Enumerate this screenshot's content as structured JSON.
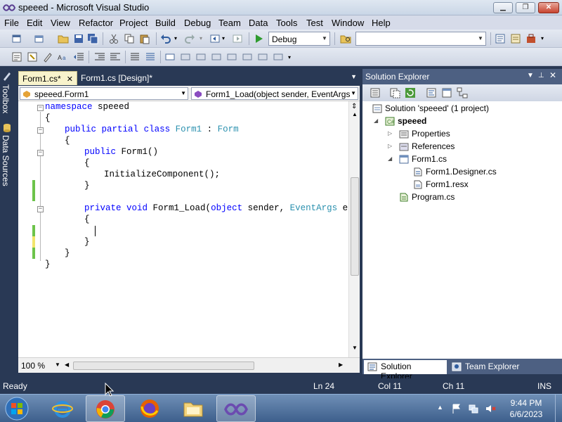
{
  "window": {
    "title": "speeed - Microsoft Visual Studio"
  },
  "menu": [
    "File",
    "Edit",
    "View",
    "Refactor",
    "Project",
    "Build",
    "Debug",
    "Team",
    "Data",
    "Tools",
    "Test",
    "Window",
    "Help"
  ],
  "toolbar": {
    "config": "Debug",
    "find_value": ""
  },
  "side_tabs": {
    "toolbox": "Toolbox",
    "data_sources": "Data Sources"
  },
  "editor": {
    "tabs": [
      {
        "label": "Form1.cs*",
        "close": "✕"
      },
      {
        "label": "Form1.cs [Design]*",
        "close": ""
      }
    ],
    "nav_class": "speeed.Form1",
    "nav_member": "Form1_Load(object sender, EventArgs",
    "zoom": "100 %",
    "code": {
      "l1": [
        "namespace",
        " speeed"
      ],
      "l2": "{",
      "l3": [
        "public",
        " ",
        "partial",
        " ",
        "class",
        " ",
        "Form1",
        " : ",
        "Form"
      ],
      "l4": "{",
      "l5": [
        "public",
        " Form1()"
      ],
      "l6": "{",
      "l7": "InitializeComponent();",
      "l8": "}",
      "l9": [
        "private",
        " ",
        "void",
        " Form1_Load(",
        "object",
        " sender, ",
        "EventArgs",
        " e)"
      ],
      "l10": "{",
      "l11": "}",
      "l12": "}",
      "l13": "}"
    }
  },
  "solution_explorer": {
    "title": "Solution Explorer",
    "tree": {
      "solution": "Solution 'speeed' (1 project)",
      "project": "speeed",
      "properties": "Properties",
      "references": "References",
      "form1": "Form1.cs",
      "designer": "Form1.Designer.cs",
      "resx": "Form1.resx",
      "program": "Program.cs"
    },
    "bottom_tabs": [
      "Solution Explorer",
      "Team Explorer"
    ]
  },
  "status": {
    "state": "Ready",
    "ln": "Ln 24",
    "col": "Col 11",
    "ch": "Ch 11",
    "mode": "INS"
  },
  "taskbar": {
    "time": "9:44 PM",
    "date": "6/6/2023"
  }
}
